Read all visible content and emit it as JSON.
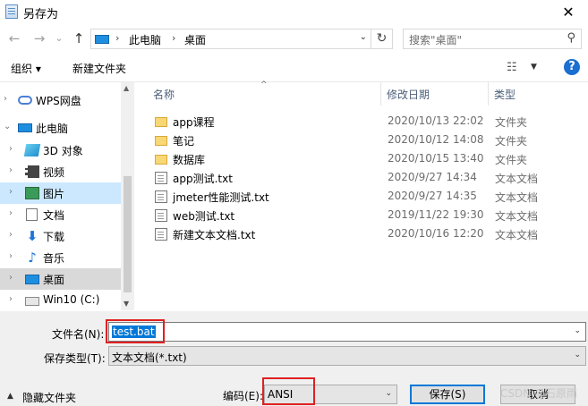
{
  "window": {
    "title": "另存为",
    "close_glyph": "✕"
  },
  "nav": {
    "back": "←",
    "forward": "→",
    "recent": "⌄",
    "up": "↑",
    "breadcrumb": [
      "此电脑",
      "桌面"
    ],
    "refresh": "↻",
    "search_placeholder": "搜索\"桌面\"",
    "search_icon": "magnifier-icon"
  },
  "toolbar": {
    "organize": "组织 ▾",
    "new_folder": "新建文件夹",
    "help": "?"
  },
  "sidebar": {
    "items": [
      {
        "label": "WPS网盘",
        "icon": "cloud-icon"
      },
      {
        "label": "此电脑",
        "icon": "computer-icon"
      },
      {
        "label": "3D 对象",
        "icon": "3d-objects-icon"
      },
      {
        "label": "视频",
        "icon": "video-icon"
      },
      {
        "label": "图片",
        "icon": "pictures-icon"
      },
      {
        "label": "文档",
        "icon": "documents-icon"
      },
      {
        "label": "下载",
        "icon": "download-icon"
      },
      {
        "label": "音乐",
        "icon": "music-icon"
      },
      {
        "label": "桌面",
        "icon": "desktop-icon"
      },
      {
        "label": "Win10 (C:)",
        "icon": "drive-icon"
      }
    ]
  },
  "columns": {
    "name": "名称",
    "modified": "修改日期",
    "type": "类型"
  },
  "files": [
    {
      "name": "app课程",
      "date": "2020/10/13 22:02",
      "type": "文件夹",
      "kind": "folder"
    },
    {
      "name": "笔记",
      "date": "2020/10/12 14:08",
      "type": "文件夹",
      "kind": "folder"
    },
    {
      "name": "数据库",
      "date": "2020/10/15 13:40",
      "type": "文件夹",
      "kind": "folder"
    },
    {
      "name": "app测试.txt",
      "date": "2020/9/27 14:34",
      "type": "文本文档",
      "kind": "text"
    },
    {
      "name": "jmeter性能测试.txt",
      "date": "2020/9/27 14:35",
      "type": "文本文档",
      "kind": "text"
    },
    {
      "name": "web测试.txt",
      "date": "2019/11/22 19:30",
      "type": "文本文档",
      "kind": "text"
    },
    {
      "name": "新建文本文档.txt",
      "date": "2020/10/16 12:20",
      "type": "文本文档",
      "kind": "text"
    }
  ],
  "form": {
    "filename_label": "文件名(N):",
    "filename_value": "test.bat",
    "savetype_label": "保存类型(T):",
    "savetype_value": "文本文档(*.txt)",
    "hide_folders": "隐藏文件夹",
    "encoding_label": "编码(E):",
    "encoding_value": "ANSI",
    "save_button": "保存(S)",
    "cancel_button": "取消"
  },
  "watermark": "CSDN @石原雨",
  "colors": {
    "accent": "#0078d7",
    "highlight": "#e02020",
    "selection": "#cce8ff"
  }
}
